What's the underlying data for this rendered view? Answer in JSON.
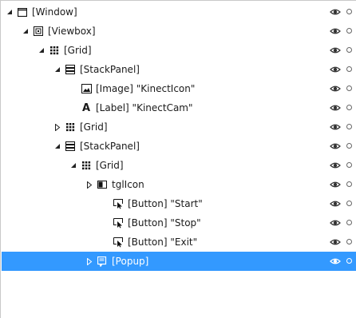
{
  "tree": [
    {
      "depth": 0,
      "expander": "expanded",
      "icon": "window-icon",
      "label": "[Window]"
    },
    {
      "depth": 1,
      "expander": "expanded",
      "icon": "viewbox-icon",
      "label": "[Viewbox]"
    },
    {
      "depth": 2,
      "expander": "expanded",
      "icon": "grid-icon",
      "label": "[Grid]"
    },
    {
      "depth": 3,
      "expander": "expanded",
      "icon": "stackpanel-icon",
      "label": "[StackPanel]"
    },
    {
      "depth": 4,
      "expander": "none",
      "icon": "image-icon",
      "label": "[Image] \"KinectIcon\""
    },
    {
      "depth": 4,
      "expander": "none",
      "icon": "label-icon",
      "label": "[Label] \"KinectCam\""
    },
    {
      "depth": 3,
      "expander": "collapsed",
      "icon": "grid-icon",
      "label": "[Grid]"
    },
    {
      "depth": 3,
      "expander": "expanded",
      "icon": "stackpanel-icon",
      "label": "[StackPanel]"
    },
    {
      "depth": 4,
      "expander": "expanded",
      "icon": "grid-icon",
      "label": "[Grid]"
    },
    {
      "depth": 5,
      "expander": "collapsed",
      "icon": "toggle-icon",
      "label": "tglIcon"
    },
    {
      "depth": 6,
      "expander": "none",
      "icon": "button-icon",
      "label": "[Button] \"Start\""
    },
    {
      "depth": 6,
      "expander": "none",
      "icon": "button-icon",
      "label": "[Button] \"Stop\""
    },
    {
      "depth": 6,
      "expander": "none",
      "icon": "button-icon",
      "label": "[Button] \"Exit\""
    },
    {
      "depth": 5,
      "expander": "collapsed",
      "icon": "popup-icon",
      "label": "[Popup]",
      "selected": true
    }
  ],
  "colors": {
    "selection": "#3399ff"
  }
}
